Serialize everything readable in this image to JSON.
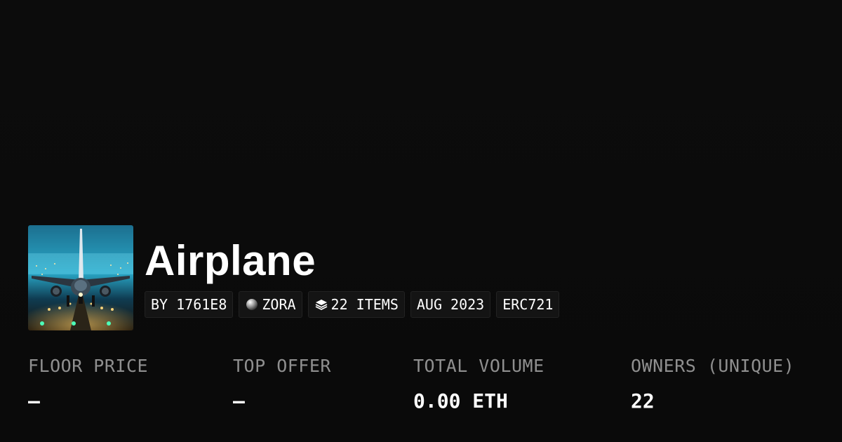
{
  "collection": {
    "title": "Airplane",
    "thumbnail_icon": "airplane-runway-image"
  },
  "chips": [
    {
      "label": "BY 1761E8",
      "icon": ""
    },
    {
      "label": "ZORA",
      "icon": "zora-orb-icon"
    },
    {
      "label": "22 ITEMS",
      "icon": "layers-icon"
    },
    {
      "label": "AUG 2023",
      "icon": ""
    },
    {
      "label": "ERC721",
      "icon": ""
    }
  ],
  "stats": [
    {
      "label": "FLOOR PRICE",
      "value": "–"
    },
    {
      "label": "TOP OFFER",
      "value": "–"
    },
    {
      "label": "TOTAL VOLUME",
      "value": "0.00 ETH"
    },
    {
      "label": "OWNERS (UNIQUE)",
      "value": "22"
    }
  ],
  "colors": {
    "background": "#0b0b0b",
    "chip_background": "#141414",
    "label_gray": "#8f8f8f",
    "text_white": "#ffffff"
  }
}
